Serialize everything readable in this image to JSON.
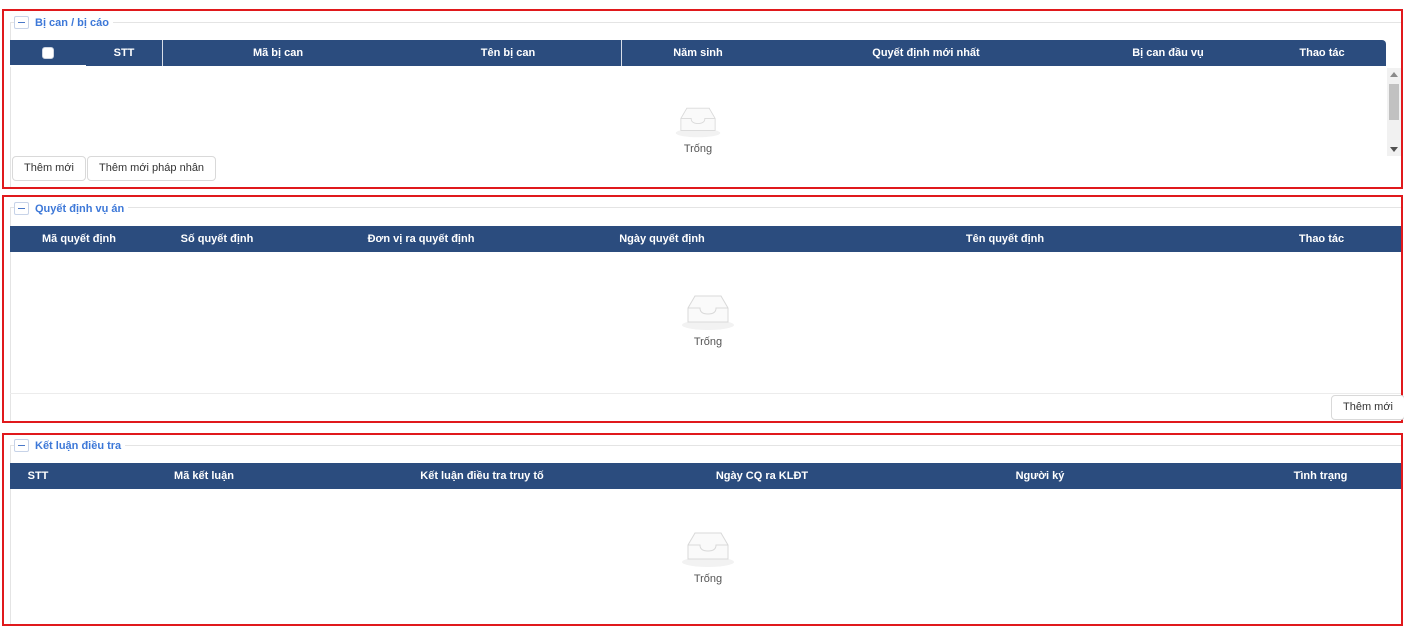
{
  "sections": {
    "defendants": {
      "title": "Bị can / bị cáo",
      "columns": [
        "STT",
        "Mã bị can",
        "Tên bị can",
        "Năm sinh",
        "Quyết định mới nhất",
        "Bị can đầu vụ",
        "Thao tác"
      ],
      "empty_text": "Trống",
      "buttons": {
        "add_new": "Thêm mới",
        "add_legal_entity": "Thêm mới pháp nhân"
      }
    },
    "case_decisions": {
      "title": "Quyết định vụ án",
      "columns": [
        "Mã quyết định",
        "Số quyết định",
        "Đơn vị ra quyết định",
        "Ngày quyết định",
        "Tên quyết định",
        "Thao tác"
      ],
      "empty_text": "Trống",
      "buttons": {
        "add_new": "Thêm mới"
      }
    },
    "investigation_conclusion": {
      "title": "Kết luận điều tra",
      "columns": [
        "STT",
        "Mã kết luận",
        "Kết luận điều tra truy tố",
        "Ngày CQ ra KLĐT",
        "Người ký",
        "Tình trạng"
      ],
      "empty_text": "Trống"
    }
  },
  "colors": {
    "header_bg": "#2b4c7e",
    "section_border": "#e0191c",
    "legend_text": "#3d78d8"
  },
  "icons": {
    "collapse": "minus-icon",
    "empty": "empty-inbox-icon"
  }
}
